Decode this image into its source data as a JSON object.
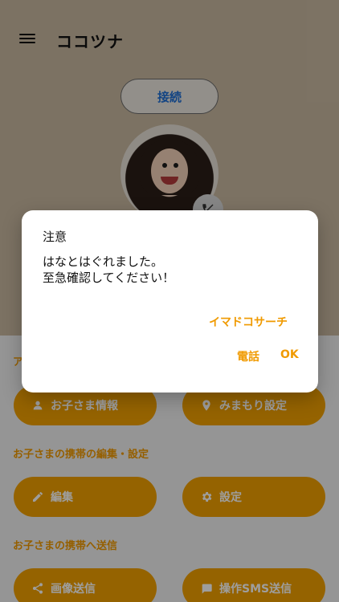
{
  "app": {
    "title": "ココツナ"
  },
  "header": {
    "connect_label": "接続"
  },
  "sections": {
    "alert_prefix": "ア",
    "edit_settings": "お子さまの携帯の編集・設定",
    "send_to_phone": "お子さまの携帯へ送信"
  },
  "buttons": {
    "child_info": "お子さま情報",
    "watch_settings": "みまもり設定",
    "edit": "編集",
    "settings": "設定",
    "image_send": "画像送信",
    "sms_send": "操作SMS送信"
  },
  "dialog": {
    "title": "注意",
    "message_line1": "はなとはぐれました。",
    "message_line2": "至急確認してください！",
    "action_search": "イマドコサーチ",
    "action_call": "電話",
    "action_ok": "OK"
  },
  "colors": {
    "accent": "#f1a000",
    "link": "#1f6fd4",
    "header_bg": "#c9b9a1"
  },
  "icons": {
    "menu": "menu-icon",
    "phone": "phone-icon",
    "person": "person-icon",
    "location": "location-pin-icon",
    "pencil": "pencil-icon",
    "gear": "gear-icon",
    "share": "share-icon",
    "message": "message-icon"
  }
}
